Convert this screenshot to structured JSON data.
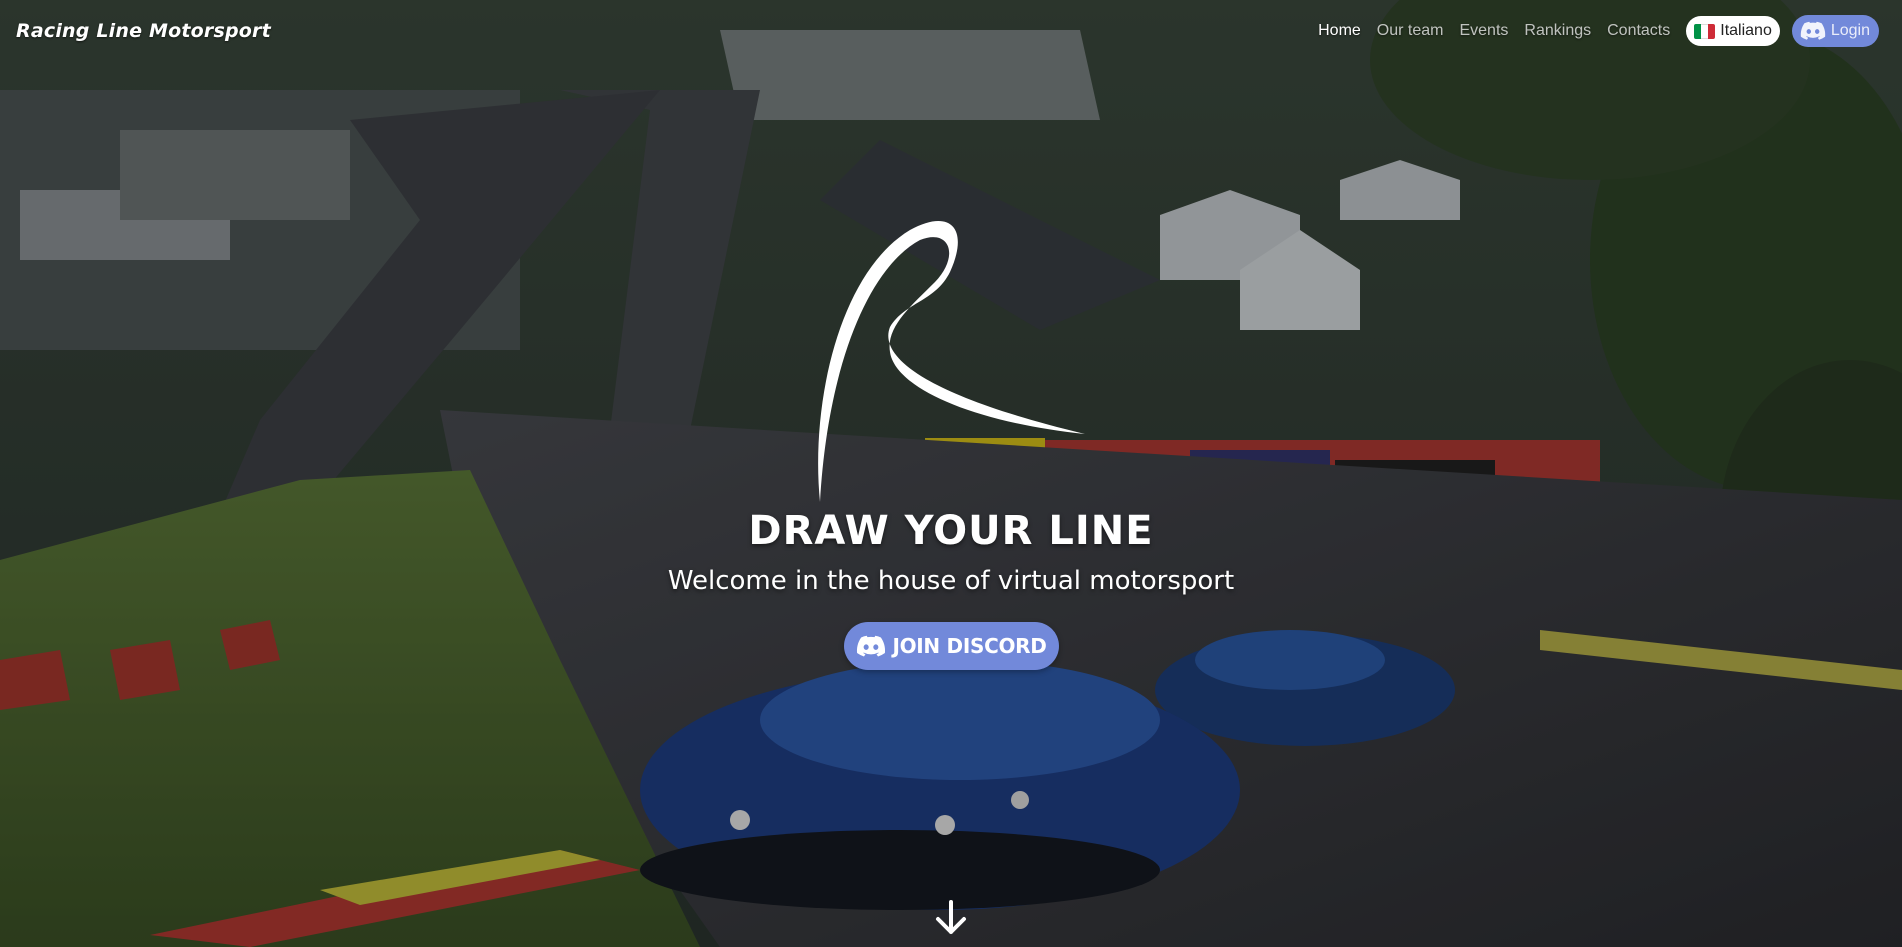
{
  "navbar": {
    "brand": "Racing Line Motorsport",
    "links": [
      {
        "label": "Home",
        "active": true
      },
      {
        "label": "Our team",
        "active": false
      },
      {
        "label": "Events",
        "active": false
      },
      {
        "label": "Rankings",
        "active": false
      },
      {
        "label": "Contacts",
        "active": false
      }
    ],
    "language": {
      "label": "Italiano",
      "flag_icon": "italy-flag-icon"
    },
    "login": {
      "label": "Login",
      "icon": "discord-icon"
    }
  },
  "hero": {
    "headline": "DRAW YOUR LINE",
    "subheadline": "Welcome in the house of virtual motorsport",
    "cta": {
      "label": "JOIN DISCORD",
      "icon": "discord-icon"
    },
    "scroll_icon": "arrow-down-icon"
  },
  "colors": {
    "discord": "#7289da",
    "text": "#ffffff",
    "flag_green": "#009246",
    "flag_white": "#ffffff",
    "flag_red": "#ce2b37"
  }
}
